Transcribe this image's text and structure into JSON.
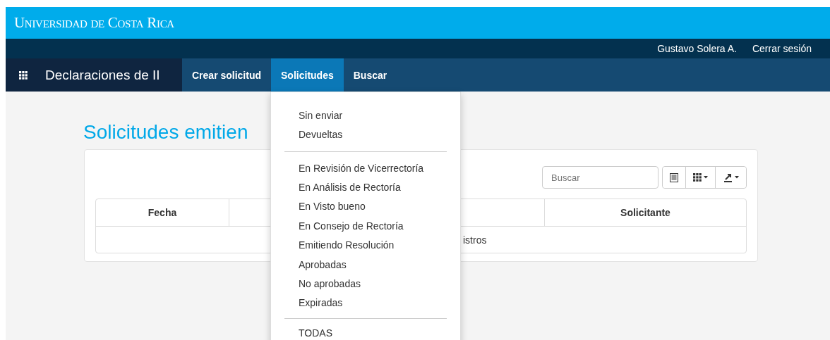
{
  "brand": {
    "title": "Universidad de Costa Rica"
  },
  "user_bar": {
    "user": "Gustavo Solera A.",
    "logout": "Cerrar sesión"
  },
  "nav": {
    "app_title": "Declaraciones de II",
    "tabs": [
      {
        "label": "Crear solicitud",
        "selected": false
      },
      {
        "label": "Solicitudes",
        "selected": true
      },
      {
        "label": "Buscar",
        "selected": false
      }
    ]
  },
  "page": {
    "title": "Solicitudes emitien"
  },
  "toolbar": {
    "search": {
      "placeholder": "Buscar"
    }
  },
  "table": {
    "columns": [
      {
        "label": "Fecha"
      },
      {
        "label": "Solicitante"
      }
    ],
    "empty_message": "istros"
  },
  "dropdown": {
    "groups": [
      [
        "Sin enviar",
        "Devueltas"
      ],
      [
        "En Revisión de Vicerrectoría",
        "En Análisis de Rectoría",
        "En Visto bueno",
        "En Consejo de Rectoría",
        "Emitiendo Resolución",
        "Aprobadas",
        "No aprobadas",
        "Expiradas"
      ],
      [
        "TODAS"
      ]
    ]
  }
}
